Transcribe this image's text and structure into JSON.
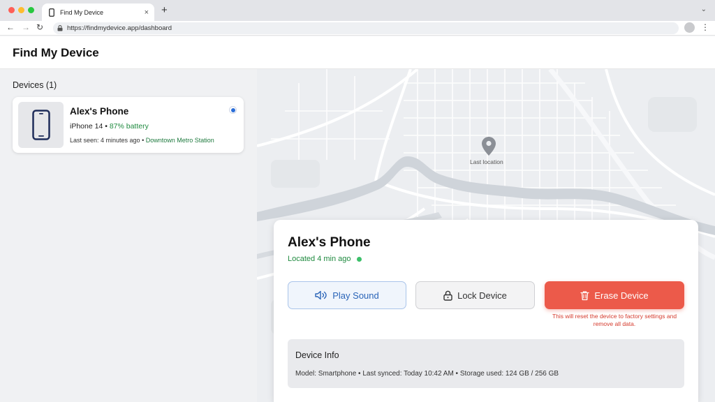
{
  "browser": {
    "tab_title": "Find My Device",
    "tab_close": "×",
    "new_tab": "+",
    "tab_menu": "⌄",
    "url": "https://findmydevice.app/dashboard",
    "back": "←",
    "forward": "→",
    "reload": "↻",
    "menu": "⋮"
  },
  "app": {
    "title": "Find My Device"
  },
  "sidebar": {
    "devices_label": "Devices (1)",
    "device": {
      "name": "Alex's Phone",
      "model": "iPhone 14",
      "separator": " • ",
      "battery": "87% battery",
      "last_seen": "Last seen: 4 minutes ago",
      "location": "Downtown Metro Station"
    }
  },
  "map": {
    "pin_label": "Last location"
  },
  "panel": {
    "title": "Alex's Phone",
    "status": "Located 4 min ago",
    "play_sound": "Play Sound",
    "lock_device": "Lock Device",
    "erase_device": "Erase Device",
    "erase_note": "This will reset the device to factory settings and remove all data.",
    "info_title": "Device Info",
    "info_text": "Model: Smartphone • Last synced: Today 10:42 AM • Storage used: 124 GB / 256 GB"
  },
  "colors": {
    "accent_blue": "#2a64b8",
    "success_green": "#1f8a3f",
    "danger_red": "#ec5a4a"
  }
}
